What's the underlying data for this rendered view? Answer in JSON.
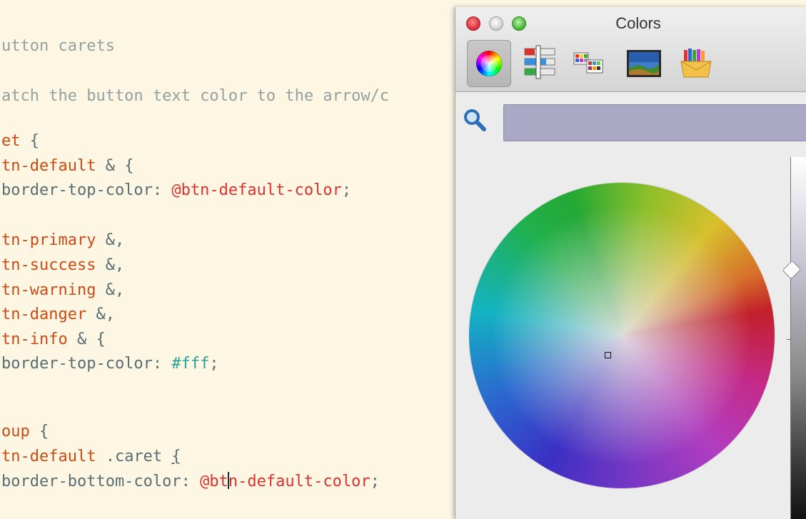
{
  "editor": {
    "lines": [
      {
        "id": "l1",
        "parts": [
          {
            "t": "utton carets",
            "c": "cm"
          }
        ]
      },
      {
        "id": "l2",
        "parts": [
          {
            "t": "atch the button text color to the arrow/c",
            "c": "cm"
          }
        ]
      },
      {
        "id": "l3",
        "parts": [
          {
            "t": "et",
            "c": "sel"
          },
          {
            "t": " {",
            "c": "punc"
          }
        ]
      },
      {
        "id": "l4",
        "parts": [
          {
            "t": "tn-default",
            "c": "sel"
          },
          {
            "t": " & {",
            "c": "punc"
          }
        ]
      },
      {
        "id": "l5",
        "parts": [
          {
            "t": "border-top-color: ",
            "c": "prop"
          },
          {
            "t": "@btn-default-color",
            "c": "var"
          },
          {
            "t": ";",
            "c": "punc"
          }
        ]
      },
      {
        "id": "l6",
        "parts": [
          {
            "t": "tn-primary",
            "c": "sel"
          },
          {
            "t": " &,",
            "c": "punc"
          }
        ]
      },
      {
        "id": "l7",
        "parts": [
          {
            "t": "tn-success",
            "c": "sel"
          },
          {
            "t": " &,",
            "c": "punc"
          }
        ]
      },
      {
        "id": "l8",
        "parts": [
          {
            "t": "tn-warning",
            "c": "sel"
          },
          {
            "t": " &,",
            "c": "punc"
          }
        ]
      },
      {
        "id": "l9",
        "parts": [
          {
            "t": "tn-danger",
            "c": "sel"
          },
          {
            "t": " &,",
            "c": "punc"
          }
        ]
      },
      {
        "id": "l10",
        "parts": [
          {
            "t": "tn-info",
            "c": "sel"
          },
          {
            "t": " & {",
            "c": "punc"
          }
        ]
      },
      {
        "id": "l11",
        "parts": [
          {
            "t": "border-top-color: ",
            "c": "prop"
          },
          {
            "t": "#fff",
            "c": "hex"
          },
          {
            "t": ";",
            "c": "punc"
          }
        ]
      },
      {
        "id": "l12",
        "parts": [
          {
            "t": "oup",
            "c": "sel"
          },
          {
            "t": " {",
            "c": "punc"
          }
        ]
      },
      {
        "id": "l13",
        "parts": [
          {
            "t": "tn-default",
            "c": "sel"
          },
          {
            "t": " .caret ",
            "c": "ident"
          },
          {
            "t": "{",
            "c": "punc bracket-match"
          }
        ]
      },
      {
        "id": "l14",
        "parts": [
          {
            "t": "border-bottom-color: ",
            "c": "prop"
          },
          {
            "t": "@bt",
            "c": "var"
          },
          {
            "t": "|",
            "c": "caret"
          },
          {
            "t": "n-default-color",
            "c": "var"
          },
          {
            "t": ";",
            "c": "punc"
          }
        ]
      }
    ]
  },
  "colors_panel": {
    "title": "Colors",
    "toolbar": [
      {
        "name": "color-wheel-tab",
        "icon": "color-wheel-icon"
      },
      {
        "name": "color-sliders-tab",
        "icon": "sliders-icon"
      },
      {
        "name": "color-palettes-tab",
        "icon": "palettes-icon"
      },
      {
        "name": "image-palettes-tab",
        "icon": "image-icon"
      },
      {
        "name": "crayons-tab",
        "icon": "crayons-icon"
      }
    ],
    "search": {
      "placeholder": "",
      "value": ""
    },
    "window_buttons": [
      "close",
      "minimize",
      "zoom"
    ],
    "selected_tab": "color-wheel-tab"
  }
}
